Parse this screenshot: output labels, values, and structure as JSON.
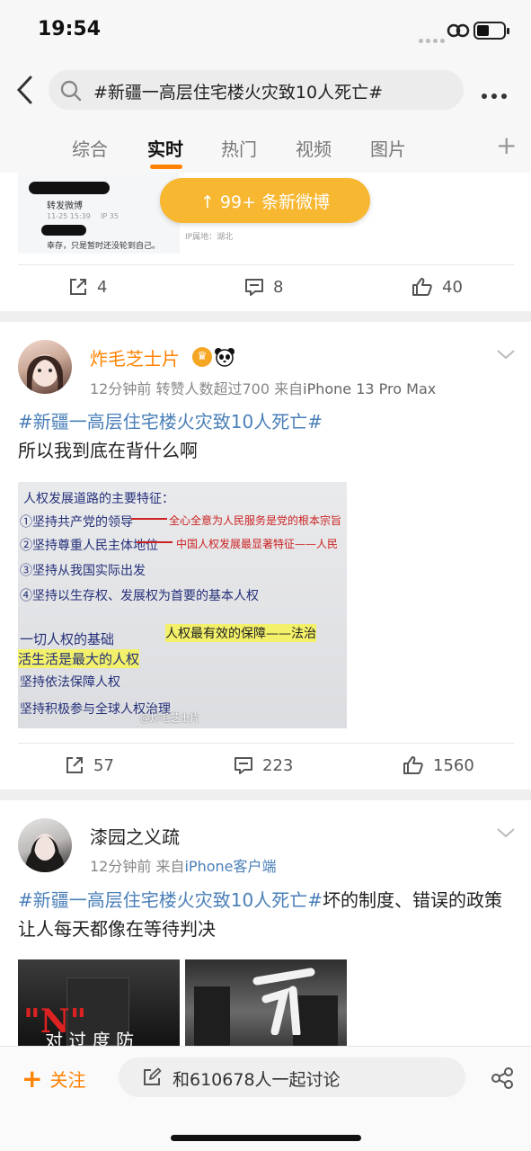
{
  "status_bar": {
    "time": "19:54"
  },
  "search": {
    "query": "#新疆一高层住宅楼火灾致10人死亡#"
  },
  "tabs": [
    {
      "label": "综合"
    },
    {
      "label": "实时"
    },
    {
      "label": "热门"
    },
    {
      "label": "视频"
    },
    {
      "label": "图片"
    }
  ],
  "new_posts_pill": "↑ 99+ 条新微博",
  "first_card": {
    "embedded": {
      "repost_label": "转发微博",
      "time1": "11-25 15:39",
      "count1": "IP 35",
      "comment": "幸存，只是暂时还没轮到自己。",
      "ip_label": "IP属地：湖北"
    },
    "reposts": "4",
    "comments": "8",
    "likes": "40"
  },
  "posts": [
    {
      "username": "炸毛芝士片",
      "time": "12分钟前",
      "extra": "转赞人数超过700",
      "source_prefix": "来自",
      "source": "iPhone 13 Pro Max",
      "hashtag": "#新疆一高层住宅楼火灾致10人死亡#",
      "text": "所以我到底在背什么啊",
      "image_lines": [
        "人权发展道路的主要特征：",
        "①坚持共产党的领导",
        "②坚持尊重人民主体地位",
        "③坚持从我国实际出发",
        "④坚持以生存权、发展权为首要的基本人权",
        "一切人权的基础",
        "活生活是最大的人权",
        "坚持依法保障人权",
        "坚持积极参与全球人权治理",
        "全心全意为人民服务是党的根本宗旨",
        "中国人权发展最显著特征——人民",
        "人权最有效的保障——法治"
      ],
      "watermark": "@炸毛芝士片",
      "reposts": "57",
      "comments": "223",
      "likes": "1560"
    },
    {
      "username": "漆园之义疏",
      "time": "12分钟前",
      "source_prefix": "来自",
      "source": "iPhone客户端",
      "hashtag": "#新疆一高层住宅楼火灾致10人死亡#",
      "text": "坏的制度、错误的政策让人每天都像在等待判决",
      "image_text": "对 过 度 防"
    }
  ],
  "bottom_bar": {
    "follow": "关注",
    "discuss": "和610678人一起讨论"
  },
  "colors": {
    "accent": "#ff8200",
    "hashtag": "#4a7fb8",
    "pill": "#f7b731"
  }
}
